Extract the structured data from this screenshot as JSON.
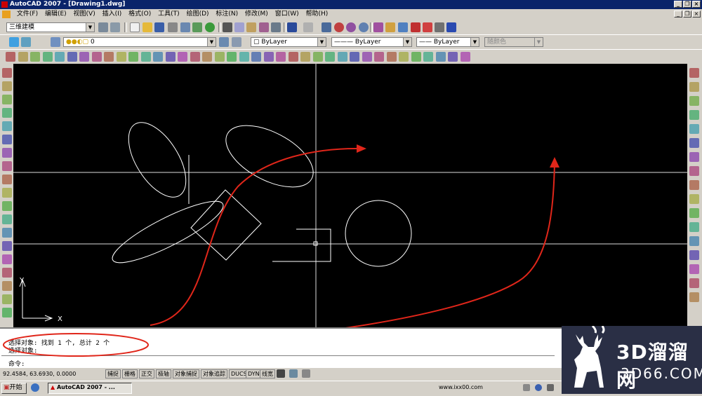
{
  "window": {
    "title": "AutoCAD 2007 - [Drawing1.dwg]"
  },
  "menu": [
    "文件(F)",
    "编辑(E)",
    "视图(V)",
    "插入(I)",
    "格式(O)",
    "工具(T)",
    "绘图(D)",
    "标注(N)",
    "修改(M)",
    "窗口(W)",
    "帮助(H)"
  ],
  "toolbar": {
    "workspace": "三维建模",
    "layer": "0",
    "color": "ByLayer",
    "linetype": "ByLayer",
    "lineweight": "ByLayer",
    "plotstyle": "随颜色"
  },
  "command": {
    "line1": "选择对象: 找到 1 个, 总计 2 个",
    "line2": "选择对象:",
    "prompt": "命令:"
  },
  "status": {
    "coords": "92.4584,  63.6930, 0.0000",
    "toggles": [
      "捕捉",
      "栅格",
      "正交",
      "极轴",
      "对象捕捉",
      "对象追踪",
      "DUCS",
      "DYN",
      "线宽"
    ]
  },
  "taskbar": {
    "start": "开始",
    "task": "AutoCAD 2007 - ...",
    "url": "www.ixx00.com"
  },
  "ucs": {
    "x": "X",
    "y": "Y"
  },
  "watermark": {
    "brand": "3D溜溜网",
    "url": "3D66.COM"
  },
  "colors": {
    "annotation": "#e0261a",
    "canvas": "#000000",
    "geometry": "#ffffff",
    "titlebar": "#0a246a"
  }
}
